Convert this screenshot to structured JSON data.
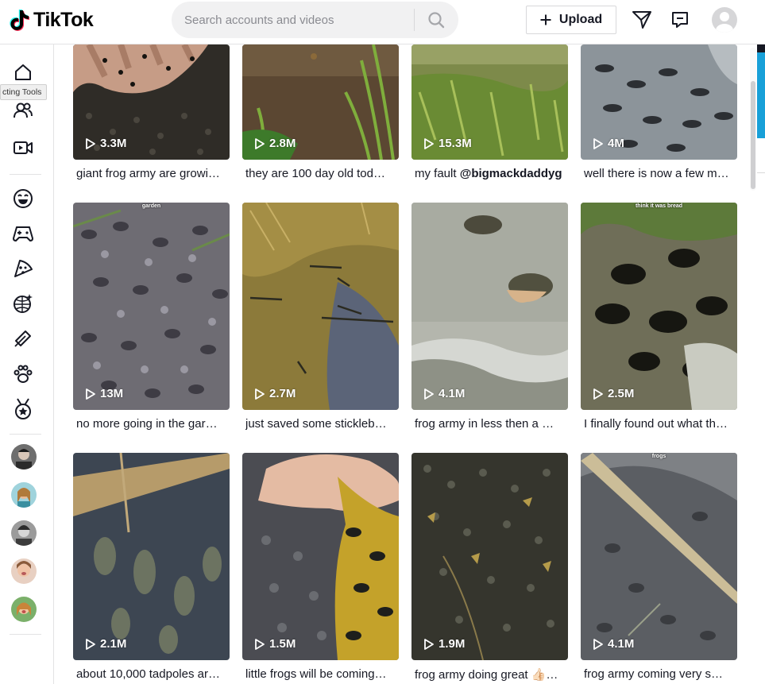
{
  "header": {
    "logo_text": "TikTok",
    "search_placeholder": "Search accounts and videos",
    "upload_label": "Upload"
  },
  "sidebar": {
    "tooltip": "cting Tools",
    "items": [
      "home-icon",
      "following-icon",
      "live-icon",
      "comedy-icon",
      "gaming-icon",
      "food-icon",
      "dance-icon",
      "beauty-icon",
      "animals-icon",
      "sports-icon"
    ]
  },
  "videos": [
    {
      "views": "3.3M",
      "caption": "giant frog army are growi…"
    },
    {
      "views": "2.8M",
      "caption": "they are 100 day old tod…"
    },
    {
      "views": "15.3M",
      "caption_prefix": "my fault ",
      "caption_mention": "@bigmackdaddyg"
    },
    {
      "views": "4M",
      "caption": "well there is now a few m…"
    },
    {
      "views": "13M",
      "caption": "no more going in the gar…",
      "overlay": "garden"
    },
    {
      "views": "2.7M",
      "caption": "just saved some stickleb…"
    },
    {
      "views": "4.1M",
      "caption": "frog army in less then a …"
    },
    {
      "views": "2.5M",
      "caption": "I finally found out what th…",
      "overlay": "think it was bread"
    },
    {
      "views": "2.1M",
      "caption": "about 10,000 tadpoles ar…"
    },
    {
      "views": "1.5M",
      "caption": "little frogs will be coming…"
    },
    {
      "views": "1.9M",
      "caption": "frog army doing great 👍🏻…"
    },
    {
      "views": "4.1M",
      "caption": "frog army coming very s…",
      "overlay": "frogs"
    }
  ],
  "colors": {
    "text": "#161823",
    "border": "#e3e3e4",
    "search_bg": "#f1f1f2"
  }
}
